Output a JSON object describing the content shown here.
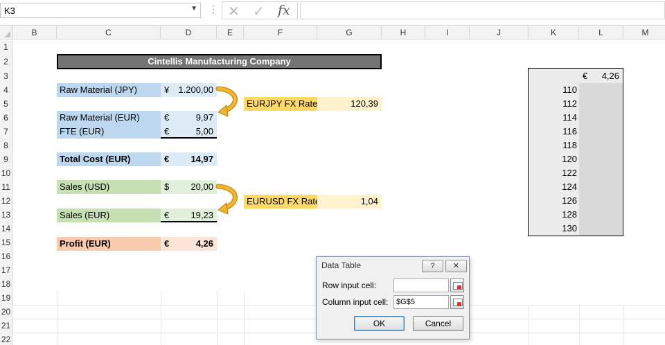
{
  "formula_bar": {
    "name_box": "K3",
    "formula": "",
    "icons": [
      "cancel-icon",
      "enter-icon",
      "function-icon"
    ]
  },
  "columns": [
    "B",
    "C",
    "D",
    "E",
    "F",
    "G",
    "H",
    "I",
    "J",
    "K",
    "L",
    "M"
  ],
  "rows": [
    "1",
    "2",
    "3",
    "4",
    "5",
    "6",
    "7",
    "8",
    "9",
    "10",
    "11",
    "12",
    "13",
    "14",
    "15",
    "16",
    "17",
    "18",
    "19",
    "20",
    "21",
    "22"
  ],
  "sheet": {
    "title": "Cintellis Manufacturing Company",
    "raw_jpy": {
      "label": "Raw Material (JPY)",
      "symbol": "¥",
      "value": "1.200,00"
    },
    "raw_eur": {
      "label": "Raw Material (EUR)",
      "symbol": "€",
      "value": "9,97"
    },
    "fte_eur": {
      "label": "FTE (EUR)",
      "symbol": "€",
      "value": "5,00"
    },
    "total_cost": {
      "label": "Total Cost (EUR)",
      "symbol": "€",
      "value": "14,97"
    },
    "sales_usd": {
      "label": "Sales (USD)",
      "symbol": "$",
      "value": "20,00"
    },
    "sales_eur": {
      "label": "Sales (EUR)",
      "symbol": "€",
      "value": "19,23"
    },
    "profit": {
      "label": "Profit (EUR)",
      "symbol": "€",
      "value": "4,26"
    },
    "eurjpy": {
      "label": "EURJPY FX Rate",
      "value": "120,39"
    },
    "eurusd": {
      "label": "EURUSD FX Rate",
      "value": "1,04"
    }
  },
  "data_table": {
    "header_symbol": "€",
    "header_value": "4,26",
    "inputs": [
      "110",
      "112",
      "114",
      "116",
      "118",
      "120",
      "122",
      "124",
      "126",
      "128",
      "130"
    ]
  },
  "dialog": {
    "title": "Data Table",
    "help_label": "?",
    "close_label": "✕",
    "row_input_label": "Row input cell:",
    "row_input_value": "",
    "column_input_label": "Column input cell:",
    "column_input_value": "$G$5",
    "ok_label": "OK",
    "cancel_label": "Cancel"
  },
  "colors": {
    "blue": "#bdd7ee",
    "orange": "#ffd966",
    "green": "#c6e0b4",
    "salmon": "#f8cbad",
    "arrow": "#e8a817"
  }
}
